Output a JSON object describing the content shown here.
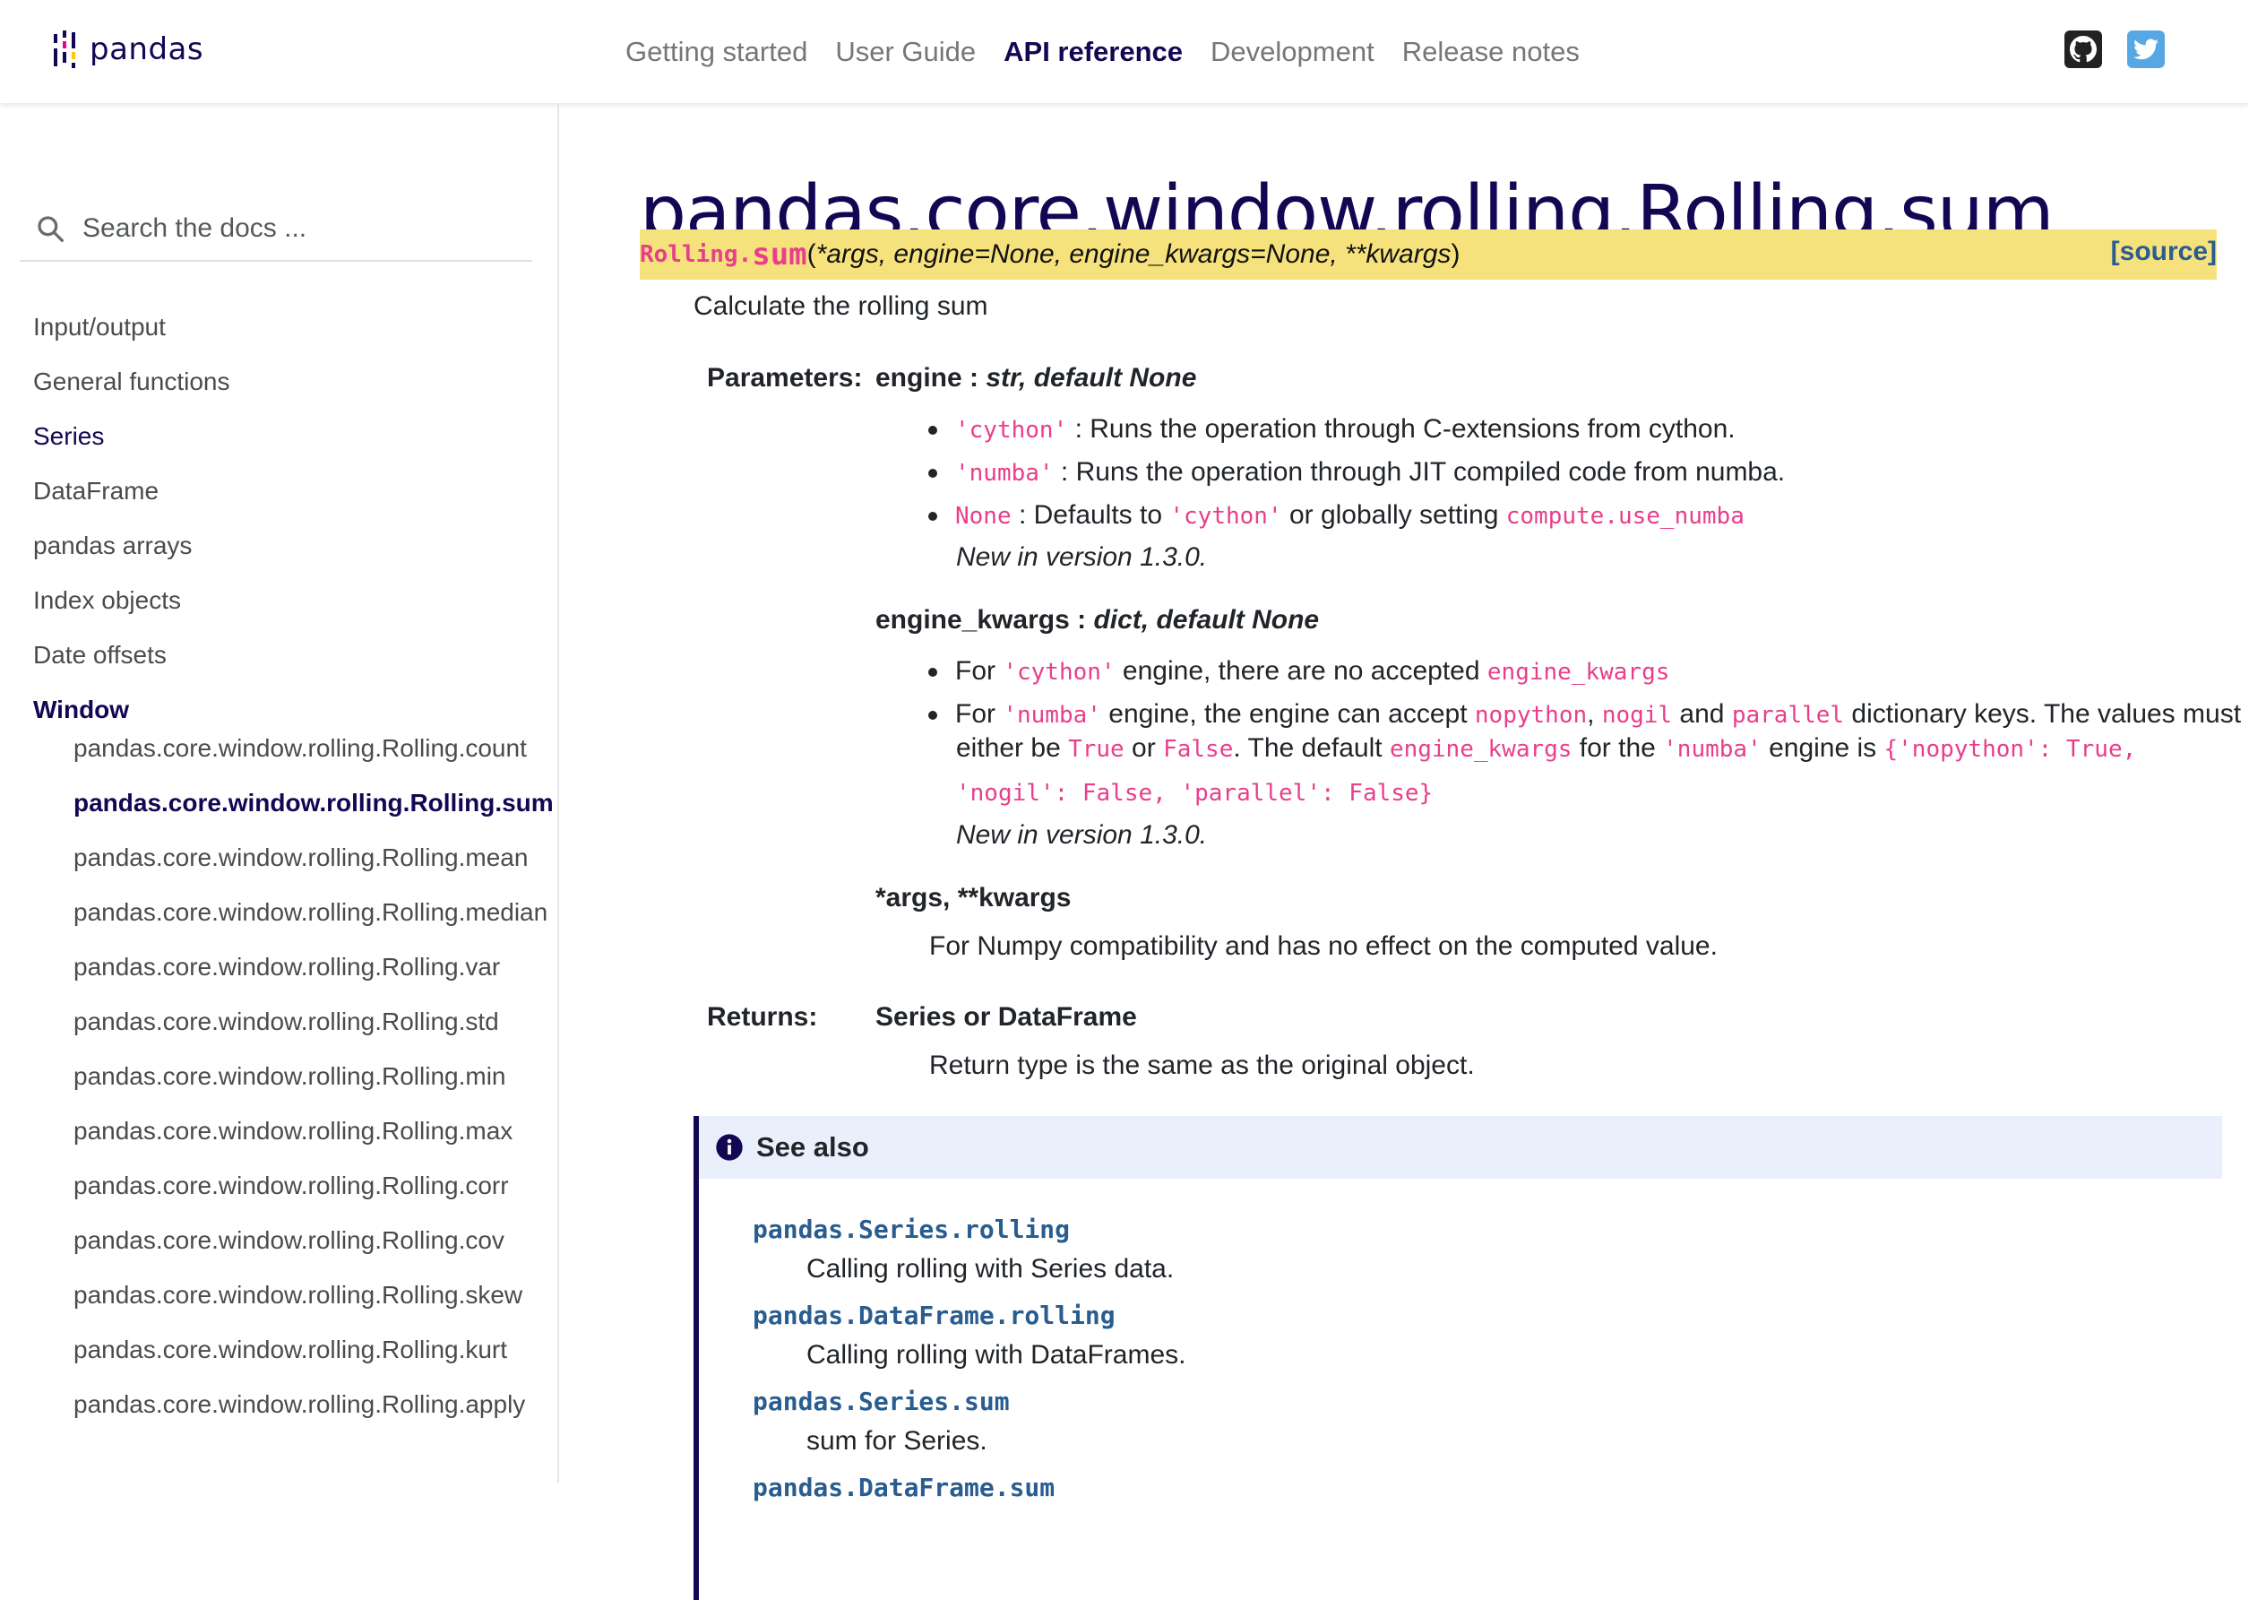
{
  "navbar": {
    "logo_text": "pandas",
    "links": [
      "Getting started",
      "User Guide",
      "API reference",
      "Development",
      "Release notes"
    ],
    "active_link": "API reference",
    "icons": [
      "github-icon",
      "twitter-icon"
    ]
  },
  "sidebar": {
    "search_placeholder": "Search the docs ...",
    "sections": [
      "Input/output",
      "General functions",
      "Series",
      "DataFrame",
      "pandas arrays",
      "Index objects",
      "Date offsets",
      "Window"
    ],
    "subitems": [
      "pandas.core.window.rolling.Rolling.count",
      "pandas.core.window.rolling.Rolling.sum",
      "pandas.core.window.rolling.Rolling.mean",
      "pandas.core.window.rolling.Rolling.median",
      "pandas.core.window.rolling.Rolling.var",
      "pandas.core.window.rolling.Rolling.std",
      "pandas.core.window.rolling.Rolling.min",
      "pandas.core.window.rolling.Rolling.max",
      "pandas.core.window.rolling.Rolling.corr",
      "pandas.core.window.rolling.Rolling.cov",
      "pandas.core.window.rolling.Rolling.skew",
      "pandas.core.window.rolling.Rolling.kurt",
      "pandas.core.window.rolling.Rolling.apply"
    ]
  },
  "main": {
    "title": "pandas.core.window.rolling.Rolling.sum",
    "signature": {
      "class": "Rolling.",
      "name": "sum",
      "open": "(",
      "params": "*args, engine=None, engine_kwargs=None, **kwargs",
      "close": ")",
      "source": "[source]"
    },
    "summary": "Calculate the rolling sum",
    "parameters_label": "Parameters:",
    "engine": {
      "name": "engine",
      "sep": " : ",
      "type": "str, default None",
      "b1_code": "'cython'",
      "b1_text": " : Runs the operation through C-extensions from cython.",
      "b2_code": "'numba'",
      "b2_text": " : Runs the operation through JIT compiled code from numba.",
      "b3_code": "None",
      "b3_text_a": " : Defaults to ",
      "b3_code2": "'cython'",
      "b3_text_b": " or globally setting ",
      "b3_code3": "compute.use_numba",
      "note": "New in version 1.3.0."
    },
    "engine_kwargs": {
      "name": "engine_kwargs",
      "sep": " : ",
      "type": "dict, default None",
      "b1_text_a": "For ",
      "b1_code": "'cython'",
      "b1_text_b": " engine, there are no accepted ",
      "b1_code2": "engine_kwargs",
      "b2_text_a": "For ",
      "b2_code": "'numba'",
      "b2_text_b": " engine, the engine can accept ",
      "b2_code2": "nopython",
      "b2_text_c": ", ",
      "b2_code3": "nogil",
      "b2_text_d": " and ",
      "b2_code4": "parallel",
      "b2_text_e": " dictionary keys. The values must",
      "b2_l2_text_a": "either be ",
      "b2_l2_code": "True",
      "b2_l2_text_b": " or ",
      "b2_l2_code2": "False",
      "b2_l2_text_c": ". The default ",
      "b2_l2_code3": "engine_kwargs",
      "b2_l2_text_d": " for the ",
      "b2_l2_code4": "'numba'",
      "b2_l2_text_e": " engine is ",
      "b2_l2_code5": "{'nopython': True,",
      "b2_l3_code": "'nogil': False, 'parallel': False}",
      "note": "New in version 1.3.0."
    },
    "args": {
      "name": "*args, **kwargs",
      "desc": "For Numpy compatibility and has no effect on the computed value."
    },
    "returns_label": "Returns:",
    "returns": {
      "type": "Series or DataFrame",
      "desc": "Return type is the same as the original object."
    },
    "see_also": {
      "title": "See also",
      "items": [
        {
          "link": "pandas.Series.rolling",
          "desc": "Calling rolling with Series data."
        },
        {
          "link": "pandas.DataFrame.rolling",
          "desc": "Calling rolling with DataFrames."
        },
        {
          "link": "pandas.Series.sum",
          "desc": "sum for Series."
        },
        {
          "link": "pandas.DataFrame.sum",
          "desc": ""
        }
      ]
    }
  }
}
